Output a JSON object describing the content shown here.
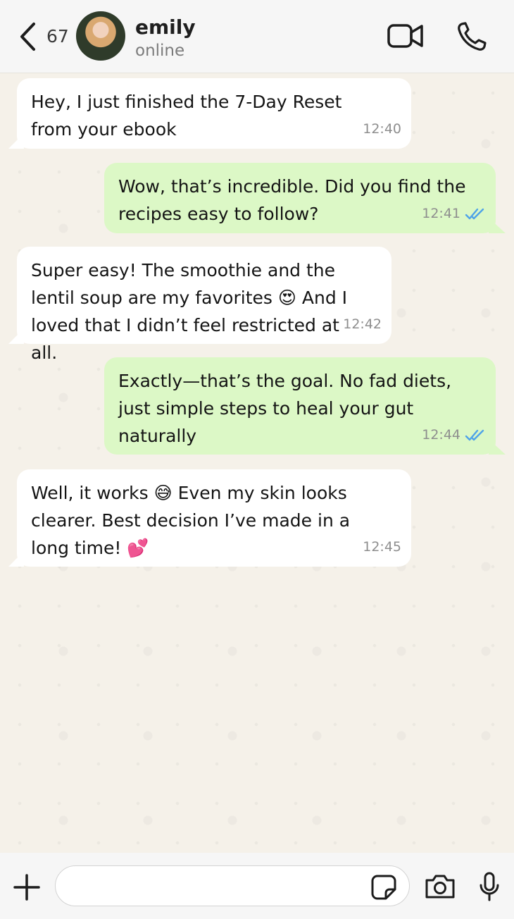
{
  "header": {
    "back_count": "67",
    "contact_name": "emily",
    "contact_status": "online"
  },
  "messages": [
    {
      "direction": "in",
      "text": "Hey, I just finished the 7-Day Reset from your ebook",
      "time": "12:40"
    },
    {
      "direction": "out",
      "text": "Wow, that’s incredible. Did you find the recipes easy to follow?",
      "time": "12:41",
      "read": true
    },
    {
      "direction": "in",
      "text_a": "Super easy! The smoothie and the lentil soup are my favorites",
      "emoji_a": "😍",
      "text_b": "And I loved that I didn’t feel restricted at all.",
      "time": "12:42"
    },
    {
      "direction": "out",
      "text": "Exactly—that’s the goal. No fad diets, just simple steps to heal your gut naturally",
      "time": "12:44",
      "read": true
    },
    {
      "direction": "in",
      "text_a": "Well, it works",
      "emoji_a": "😅",
      "text_b": "Even my skin looks clearer. Best decision I’ve made in a long time!",
      "emoji_b": "💕",
      "time": "12:45"
    }
  ],
  "composer": {
    "input_value": "",
    "input_placeholder": ""
  },
  "colors": {
    "incoming_bubble": "#ffffff",
    "outgoing_bubble": "#dcf8c6",
    "read_ticks": "#4fa3e8"
  },
  "icons": [
    "chevron-left-icon",
    "video-call-icon",
    "phone-icon",
    "plus-icon",
    "sticker-icon",
    "camera-icon",
    "microphone-icon",
    "double-check-icon"
  ]
}
